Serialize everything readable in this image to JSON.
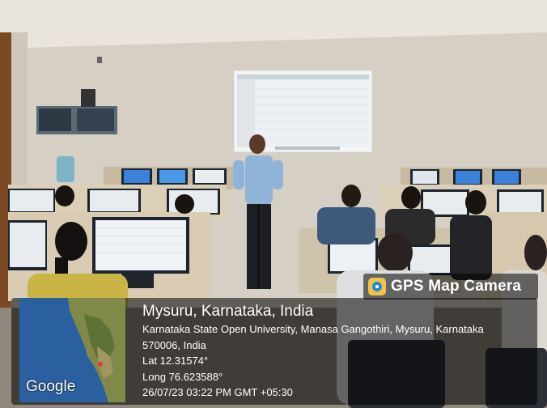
{
  "gps_badge": {
    "label": "GPS Map Camera",
    "icon": "gps-map-camera-app-icon"
  },
  "location": {
    "title": "Mysuru, Karnataka, India",
    "address_line_1": "Karnataka State Open University, Manasa Gangothiri, Mysuru, Karnataka",
    "address_line_2": "570006, India",
    "latitude": "Lat 12.31574°",
    "longitude": "Long 76.623588°",
    "timestamp": "26/07/23 03:22 PM GMT +05:30"
  },
  "map_thumbnail": {
    "provider": "Google"
  },
  "colors": {
    "wall": "#d9d2c6",
    "ceiling": "#ece8e1",
    "floor": "#9a9387",
    "desk": "#e2d7c4",
    "overlay": "#000000",
    "screen_blue": "#3b82d8"
  }
}
